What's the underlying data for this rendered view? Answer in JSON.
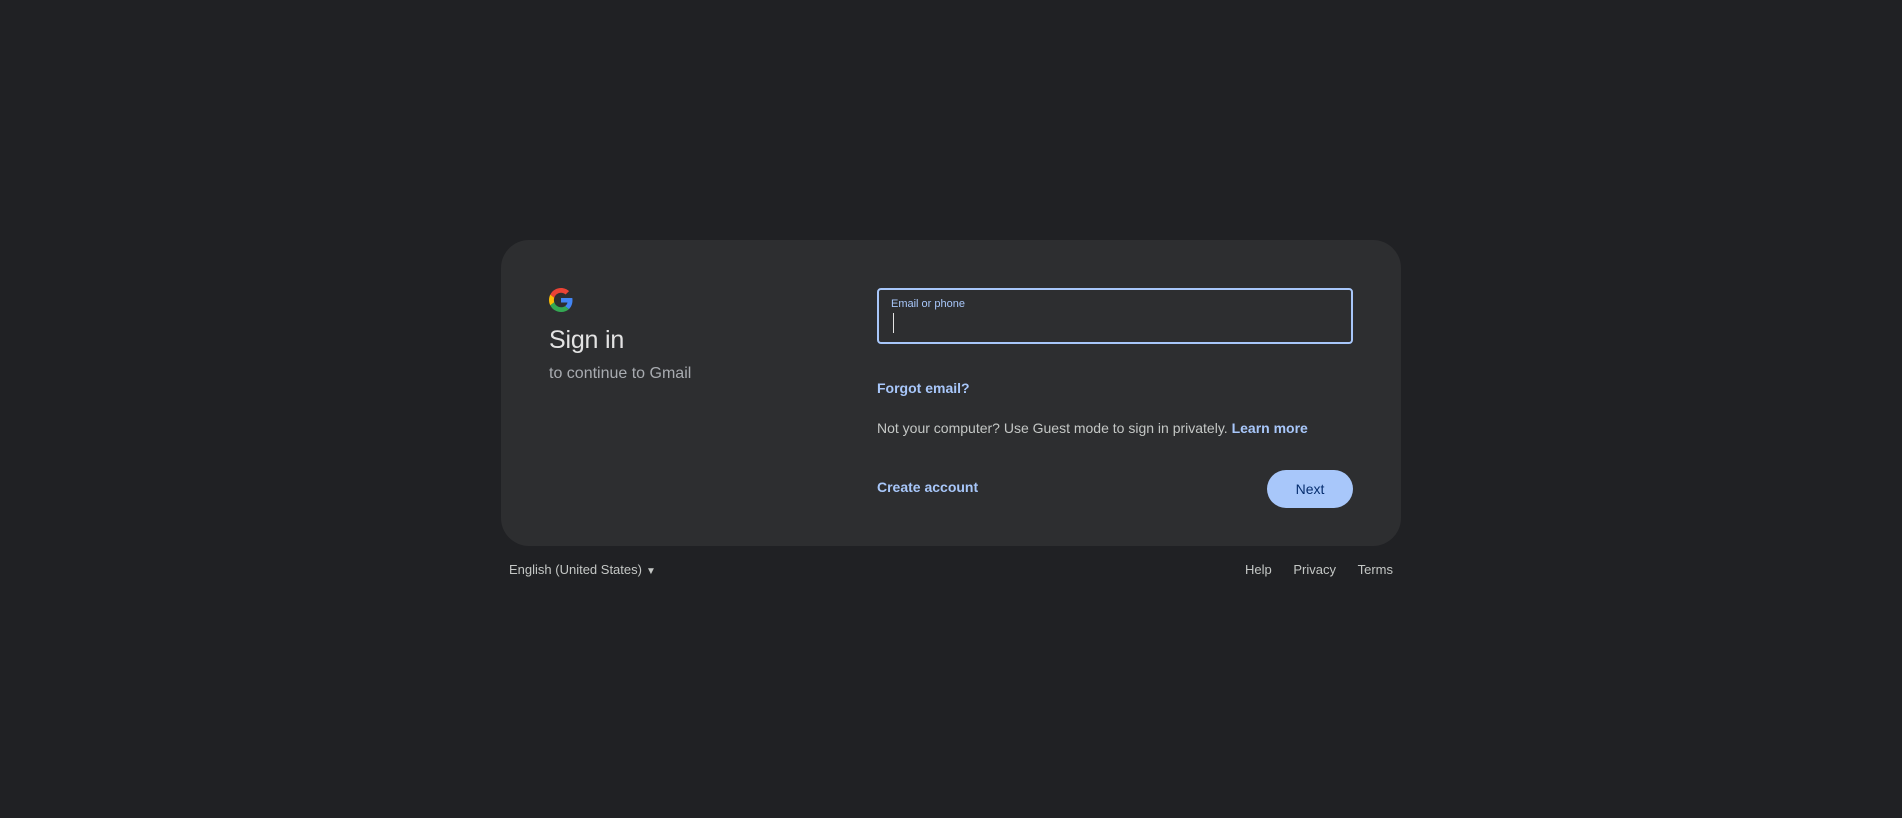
{
  "brand": {
    "logo_icon": "google-g-icon",
    "colors": {
      "blue": "#4285F4",
      "red": "#EA4335",
      "yellow": "#FBBC05",
      "green": "#34A853",
      "accent": "#a8c7fa",
      "background": "#202124",
      "card": "#2d2e30"
    }
  },
  "card": {
    "title": "Sign in",
    "subtitle": "to continue to Gmail"
  },
  "form": {
    "email_label": "Email or phone",
    "email_value": "",
    "forgot_email": "Forgot email?",
    "guest_text": "Not your computer? Use Guest mode to sign in privately.",
    "learn_more": "Learn more",
    "create_account": "Create account",
    "next": "Next"
  },
  "footer": {
    "language": "English (United States)",
    "language_arrow": "▼",
    "links": [
      "Help",
      "Privacy",
      "Terms"
    ]
  }
}
